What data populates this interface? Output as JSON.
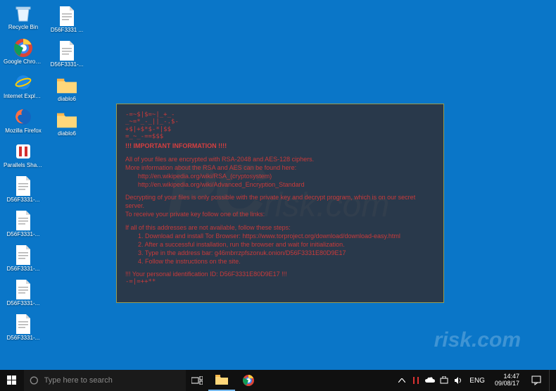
{
  "desktop": {
    "col1": [
      {
        "name": "recycle-bin",
        "label": "Recycle Bin",
        "kind": "bin"
      },
      {
        "name": "google-chrome",
        "label": "Google Chrome",
        "kind": "chrome"
      },
      {
        "name": "internet-explorer",
        "label": "Internet Explorer",
        "kind": "ie"
      },
      {
        "name": "mozilla-firefox",
        "label": "Mozilla Firefox",
        "kind": "firefox"
      },
      {
        "name": "parallels-share",
        "label": "Parallels Share...",
        "kind": "parallels"
      },
      {
        "name": "file-1",
        "label": "D56F3331-...",
        "kind": "file"
      },
      {
        "name": "file-2",
        "label": "D56F3331-...",
        "kind": "file"
      },
      {
        "name": "file-3",
        "label": "D56F3331-...",
        "kind": "file"
      },
      {
        "name": "file-4",
        "label": "D56F3331-...",
        "kind": "file"
      },
      {
        "name": "file-5",
        "label": "D56F3331-...",
        "kind": "file"
      }
    ],
    "col2": [
      {
        "name": "file-6",
        "label": "D56F3331 ...",
        "kind": "file"
      },
      {
        "name": "file-7",
        "label": "D56F3331-...",
        "kind": "file"
      },
      {
        "name": "folder-1",
        "label": "diablo6",
        "kind": "folder"
      },
      {
        "name": "folder-2",
        "label": "diablo6",
        "kind": "folder"
      }
    ]
  },
  "note": {
    "ascii1": "-=~$|$=~|_+_-",
    "ascii2": "_~=*_-_||_-.$-",
    "ascii3": "+$|+$*$-*|$$",
    "ascii4": "=_~_-==$$$",
    "important": "!!! IMPORTANT INFORMATION !!!!",
    "p1": "All of your files are encrypted with RSA-2048 and AES-128 ciphers.",
    "p2": "More information about the RSA and AES can be found here:",
    "link1": "http://en.wikipedia.org/wiki/RSA_(cryptosystem)",
    "link2": "http://en.wikipedia.org/wiki/Advanced_Encryption_Standard",
    "p3": "Decrypting of your files is only possible with the private key and decrypt program, which is on our secret server.",
    "p4": "To receive your private key follow one of the links:",
    "p5": "If all of this addresses are not available, follow these steps:",
    "s1": "1. Download and install Tor Browser: https://www.torproject.org/download/download-easy.html",
    "s2": "2. After a successful installation, run the browser and wait for initialization.",
    "s3": "3. Type in the address bar: g46mbrrzpfszonuk.onion/D56F3331E80D9E17",
    "s4": "4. Follow the instructions on the site.",
    "id": "!!! Your personal identification ID: D56F3331E80D9E17 !!!",
    "foot": "-=|=++**"
  },
  "taskbar": {
    "search_placeholder": "Type here to search",
    "lang": "ENG",
    "time": "14:47",
    "date": "09/08/17"
  },
  "watermark": {
    "main": "PC",
    "tail": "risk.com",
    "lower": "risk.com"
  }
}
